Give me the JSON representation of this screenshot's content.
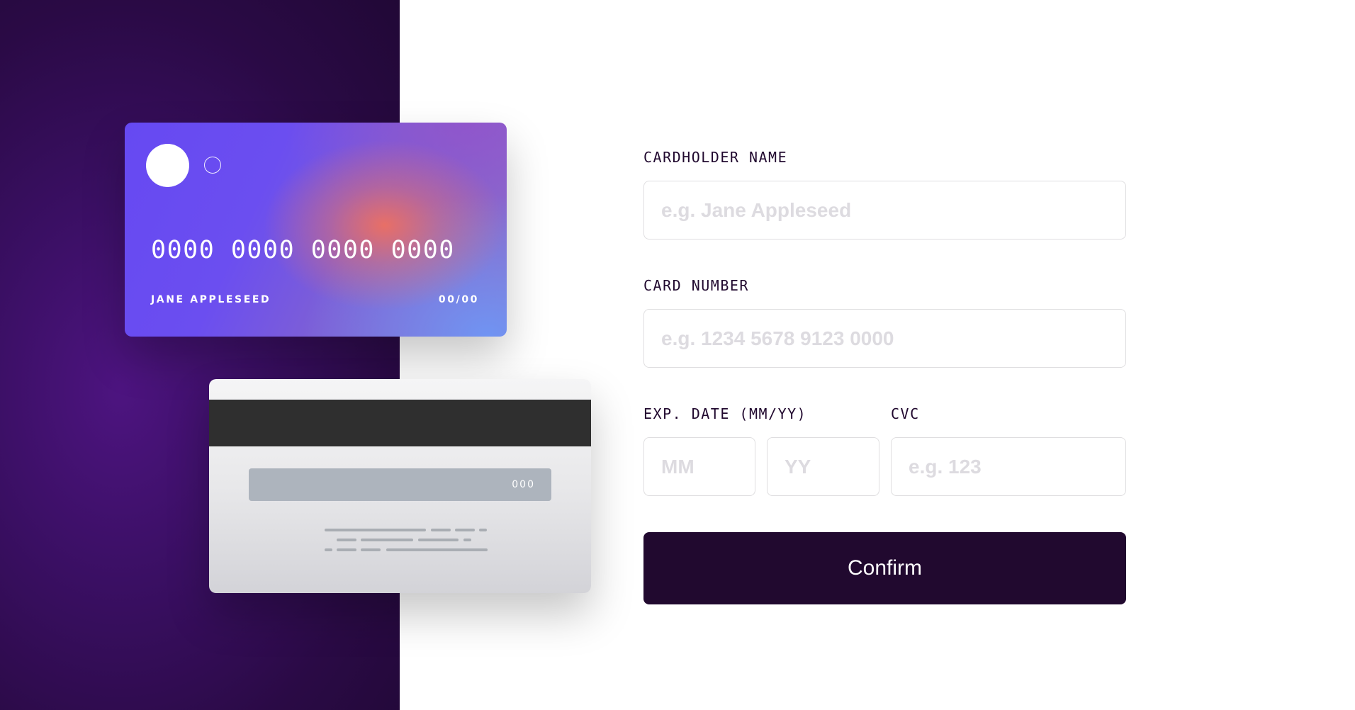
{
  "card_front": {
    "number": "0000 0000 0000 0000",
    "name": "JANE APPLESEED",
    "expiry": "00/00"
  },
  "card_back": {
    "cvc": "000"
  },
  "form": {
    "name": {
      "label": "CARDHOLDER NAME",
      "placeholder": "e.g. Jane Appleseed"
    },
    "number": {
      "label": "CARD NUMBER",
      "placeholder": "e.g. 1234 5678 9123 0000"
    },
    "expiry": {
      "label": "EXP. DATE (MM/YY)",
      "month_placeholder": "MM",
      "year_placeholder": "YY"
    },
    "cvc": {
      "label": "CVC",
      "placeholder": "e.g. 123"
    },
    "confirm_label": "Confirm"
  },
  "colors": {
    "accent": "#21092f",
    "panel_gradient_dark": "#210836",
    "panel_gradient_light": "#4d1480",
    "input_border": "#dfdee0",
    "placeholder": "#dddbe0"
  }
}
